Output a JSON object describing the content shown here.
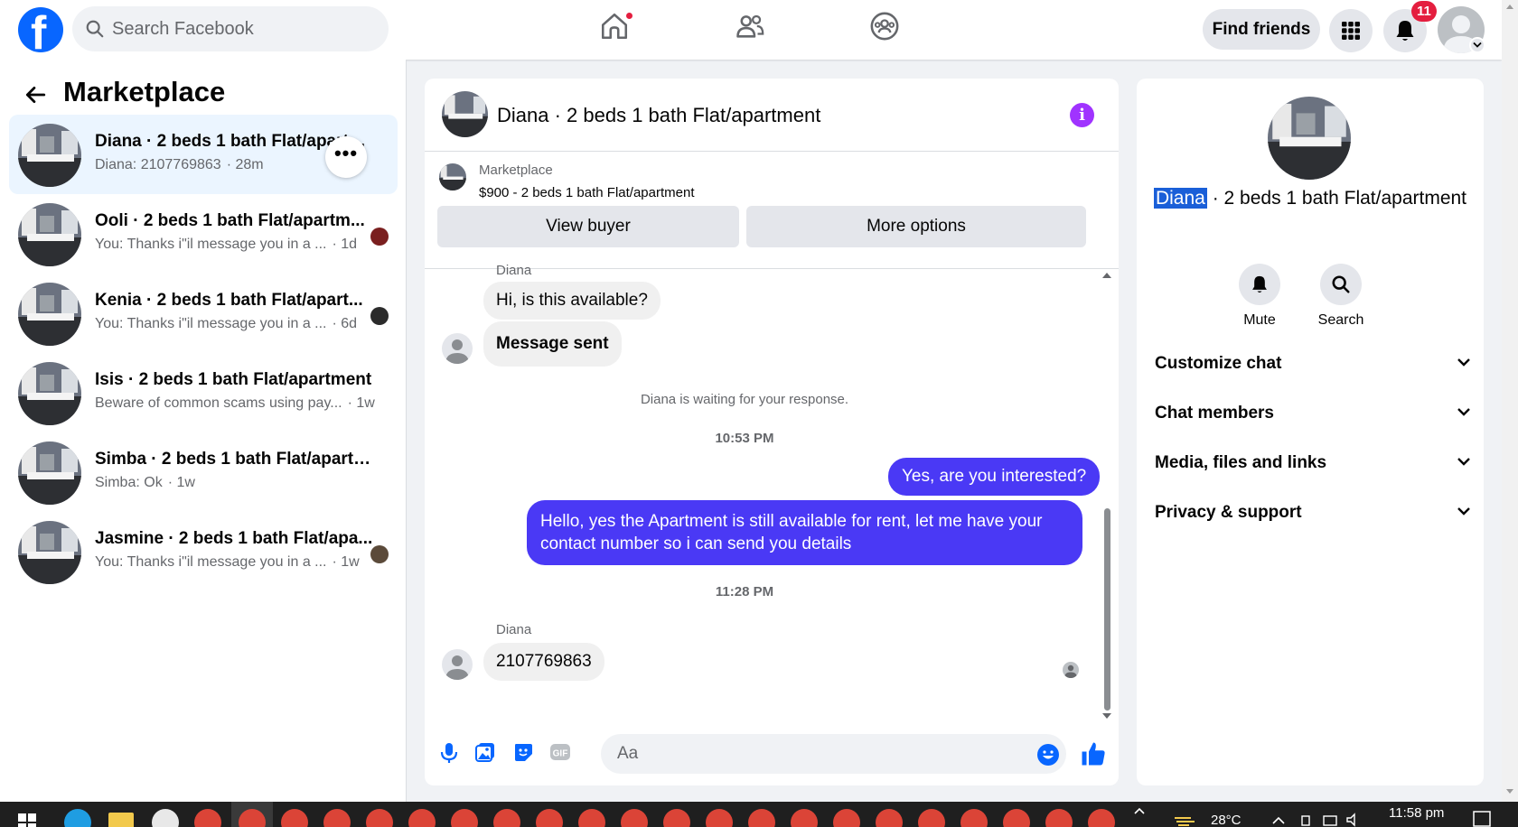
{
  "topbar": {
    "logo": "facebook-logo",
    "search_placeholder": "Search Facebook",
    "nav_icons": [
      "home-icon",
      "friends-icon",
      "groups-icon"
    ],
    "find_friends_label": "Find friends",
    "notification_count": "11"
  },
  "sidebar": {
    "title": "Marketplace",
    "conversations": [
      {
        "title": "Diana · 2 beds 1 bath Flat/apartment",
        "preview": "Diana: 2107769863",
        "time": "· 28m"
      },
      {
        "title": "Ooli · 2 beds 1 bath Flat/apartm...",
        "preview": "You: Thanks i\"il message you in a ...",
        "time": "· 1d"
      },
      {
        "title": "Kenia · 2 beds 1 bath Flat/apart...",
        "preview": "You: Thanks i\"il message you in a ...",
        "time": "· 6d"
      },
      {
        "title": "Isis · 2 beds 1 bath Flat/apartment",
        "preview": "Beware of common scams using pay...",
        "time": "· 1w"
      },
      {
        "title": "Simba · 2 beds 1 bath Flat/apartm...",
        "preview": "Simba: Ok",
        "time": "· 1w"
      },
      {
        "title": "Jasmine · 2 beds 1 bath Flat/apa...",
        "preview": "You: Thanks i\"il message you in a ...",
        "time": "· 1w"
      }
    ]
  },
  "chat": {
    "header_title": "Diana · 2 beds 1 bath Flat/apartment",
    "marketplace_label": "Marketplace",
    "listing": "$900 - 2 beds 1 bath Flat/apartment",
    "view_buyer_label": "View buyer",
    "more_options_label": "More options",
    "partial_sender": "Diana",
    "messages": {
      "in1": "Hi, is this available?",
      "in2": "Message sent",
      "waiting": "Diana is waiting for your response.",
      "time1": "10:53 PM",
      "out1": "Yes, are you interested?",
      "out2": "Hello, yes the Apartment is still available for rent, let me have your contact number so i can send you details",
      "time2": "11:28 PM",
      "sender": "Diana",
      "in3": "2107769863"
    },
    "composer_placeholder": "Aa"
  },
  "right_panel": {
    "name_highlight": "Diana",
    "name_rest": "· 2 beds 1 bath Flat/apartment",
    "mute_label": "Mute",
    "search_label": "Search",
    "sections": [
      "Customize chat",
      "Chat members",
      "Media, files and links",
      "Privacy & support"
    ]
  },
  "taskbar": {
    "temperature": "28°C",
    "clock": "11:58 pm"
  },
  "colors": {
    "brand": "#0866ff",
    "outgoing_bubble": "#4a39f5",
    "info_icon": "#a033ff",
    "badge": "#e41e3f"
  }
}
